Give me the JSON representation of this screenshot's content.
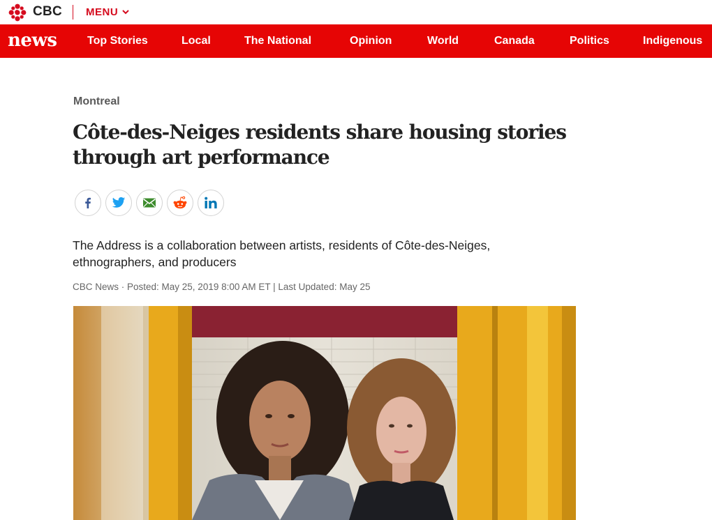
{
  "topbar": {
    "brand": "CBC",
    "menu_label": "MENU"
  },
  "navbar": {
    "logo": "news",
    "items": [
      "Top Stories",
      "Local",
      "The National",
      "Opinion",
      "World",
      "Canada",
      "Politics",
      "Indigenous"
    ]
  },
  "article": {
    "kicker": "Montreal",
    "headline": "Côte-des-Neiges residents share housing stories through art performance",
    "deck": "The Address is a collaboration between artists, residents of Côte-des-Neiges, ethnographers, and producers",
    "byline": "CBC News · Posted: May 25, 2019 8:00 AM ET | Last Updated: May 25"
  },
  "share": {
    "icons": [
      "facebook-icon",
      "twitter-icon",
      "email-icon",
      "reddit-icon",
      "linkedin-icon"
    ]
  },
  "colors": {
    "brand_red": "#e60505",
    "cbc_red": "#d50b1e"
  }
}
